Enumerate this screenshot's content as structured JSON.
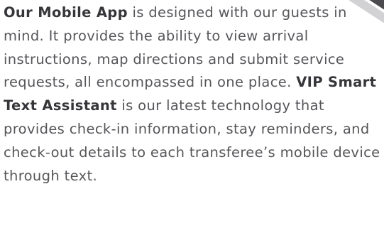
{
  "paragraph": {
    "lead_bold": "Our Mobile App",
    "part1": " is designed with our guests in mind. It provides the ability to view arrival instructions, map directions and submit service requests, all encompassed in one place. ",
    "mid_bold": "VIP Smart Text Assistant",
    "part2": " is our latest technology that provides check-in information, stay reminders, and check-out details to each transferee’s mobile device through text."
  },
  "colors": {
    "text": "#56565a",
    "bold_text": "#36363a",
    "stripe_dark": "#4b4b4f",
    "stripe_light": "#d2d2d5"
  }
}
